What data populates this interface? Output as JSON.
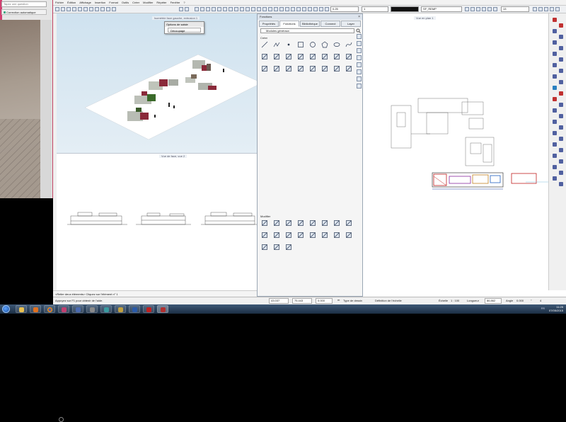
{
  "photo_app": {
    "search_placeholder": "Tapez une question",
    "correction_label": "Correction automatique"
  },
  "menu": [
    "Fichier",
    "Édition",
    "Affichage",
    "Insertion",
    "Format",
    "Outils",
    "Créer",
    "Modifier",
    "Répéter",
    "Fenêtre",
    "?"
  ],
  "toolbar": {
    "pen_width": "0.25",
    "line_type": "1",
    "layer": "SF_REMP",
    "scale": "13"
  },
  "views": {
    "view3d_title": "Isométrie face gauche, extrusion 1",
    "face_title": "Vue de face, vue 2",
    "plan_title": "Vue en plan 1"
  },
  "saisie_menu": {
    "title": "Options de saisie",
    "option": "Découpage"
  },
  "palette": {
    "title": "Fonctions",
    "tabs": [
      "Propriétés",
      "Fonctions",
      "Bibliothèque",
      "Connect",
      "Layer"
    ],
    "active_tab": "Fonctions",
    "module": "Modules généraux",
    "section_create": "Créer",
    "section_modify": "Modifier",
    "create_icons": [
      "line-icon",
      "polyline-icon",
      "point-icon",
      "rectangle-icon",
      "circle-icon",
      "polygon-icon",
      "ellipse-icon",
      "spline-icon",
      "crosshair-icon",
      "curve-icon",
      "arc-icon",
      "hatch-icon",
      "fill-icon",
      "pattern-icon",
      "image-icon",
      "text-icon",
      "dimension-icon",
      "dim-line-icon",
      "angle-dim-icon",
      "label-icon",
      "level-icon",
      "grid-icon",
      "table-icon",
      "measure-icon"
    ],
    "modify_icons": [
      "stretch-icon",
      "fillet-icon",
      "chamfer-icon",
      "trim-icon",
      "delete-segment-icon",
      "extend-icon",
      "divide-icon",
      "offset-icon",
      "modify-distance-icon",
      "copy-icon",
      "split-icon",
      "mirror-icon",
      "move-icon",
      "rotate-icon",
      "scale-icon",
      "join-icon",
      "explode-icon",
      "properties-icon",
      "convert-icon"
    ]
  },
  "command_line": "<Relier deux éléments> Cliquez sur l'élément n° 1",
  "status_bar": {
    "hint": "Appuyez sur F1 pour obtenir de l'aide.",
    "draw_type": "Type de dessin",
    "scale_def": "Définition de l'échelle",
    "x_val": "43.037",
    "y_val": "75.443",
    "z_val": "0.000",
    "length_val": "86.862",
    "echelle_label": "Échelle",
    "echelle_val": "1 : 100",
    "longueur_label": "Longueur",
    "angle_label": "Angle",
    "angle_val": "0.000",
    "unit": "m",
    "deg": "°",
    "angle_count": "4"
  },
  "taskbar": {
    "time": "11:25",
    "date": "07/05/2015",
    "lang": "FR"
  },
  "colors": {
    "accent": "#2a5a9a",
    "selection": "#c02020"
  }
}
